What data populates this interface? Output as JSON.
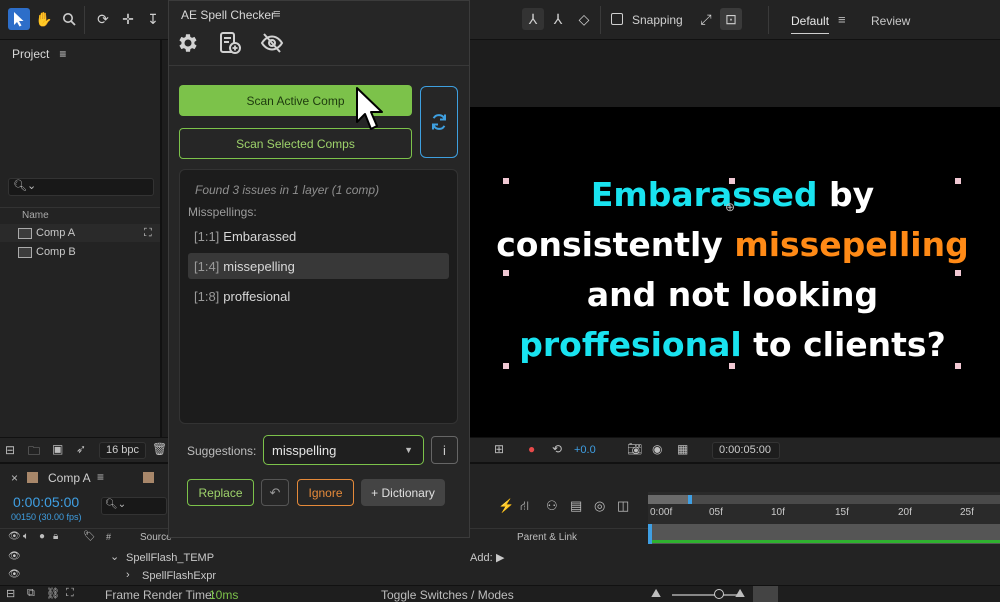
{
  "workspace": {
    "tabs": [
      "Default",
      "Review"
    ],
    "snapping_label": "Snapping"
  },
  "project": {
    "title": "Project",
    "search_placeholder": "",
    "column_name": "Name",
    "items": [
      {
        "label": "Comp A"
      },
      {
        "label": "Comp B"
      }
    ]
  },
  "plugin": {
    "title": "AE Spell Checker",
    "buttons": {
      "scan_active": "Scan Active Comp",
      "scan_selected": "Scan Selected Comps"
    },
    "summary": "Found 3 issues in 1 layer (1 comp)",
    "category": "Misspellings:",
    "issues": [
      {
        "pos": "[1:1]",
        "word": "Embarassed"
      },
      {
        "pos": "[1:4]",
        "word": "missepelling"
      },
      {
        "pos": "[1:8]",
        "word": "proffesional"
      }
    ],
    "suggestions_label": "Suggestions:",
    "suggestion_value": "misspelling",
    "info_label": "i",
    "actions": {
      "replace": "Replace",
      "ignore": "Ignore",
      "dictionary": "+ Dictionary"
    }
  },
  "canvas_text": {
    "line1": {
      "hl": "Embarassed",
      "rest": " by"
    },
    "line2": {
      "pre": "consistently ",
      "hl": "missepelling"
    },
    "line3": {
      "text": "and not looking"
    },
    "line4": {
      "hl": "proffesional",
      "rest": " to clients?"
    }
  },
  "viewer_bar": {
    "bpc": "16 bpc",
    "exposure": "+0.0",
    "timecode": "0:00:05:00"
  },
  "timeline": {
    "tab": "Comp A",
    "timecode": "0:00:05:00",
    "fps": "00150 (30.00 fps)",
    "col_source": "Source",
    "col_parent": "Parent & Link",
    "ruler_labels": [
      "0:00f",
      "05f",
      "10f",
      "15f",
      "20f",
      "25f"
    ],
    "layers": [
      {
        "name": "SpellFlash_TEMP"
      },
      {
        "name": "SpellFlashExpr"
      }
    ],
    "add_label": "Add:",
    "render_time_label": "Frame Render Time:",
    "render_time": "10ms",
    "toggle_label": "Toggle Switches / Modes"
  },
  "colors": {
    "accent_green": "#7cc24a",
    "accent_blue": "#3e9fdf",
    "accent_orange": "#e58a3a",
    "highlight_cyan": "#19e3f0",
    "highlight_orange": "#ff8a16"
  }
}
